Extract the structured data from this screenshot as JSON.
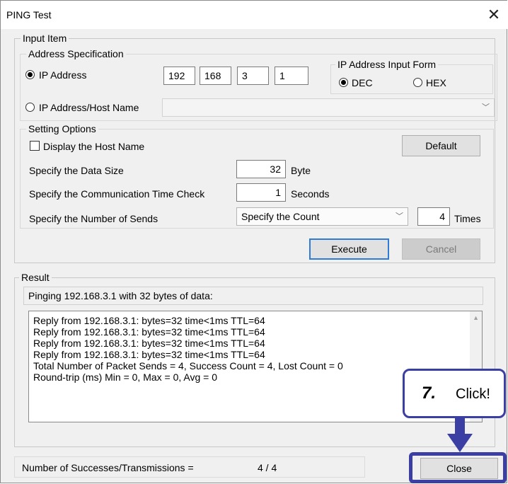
{
  "window": {
    "title": "PING Test"
  },
  "input_item": {
    "group_label": "Input Item",
    "address_spec": {
      "group_label": "Address Specification",
      "ip_address_label": "IP Address",
      "ip_octets": [
        "192",
        "168",
        "3",
        "1"
      ],
      "input_form": {
        "label": "IP Address Input Form",
        "dec": "DEC",
        "hex": "HEX",
        "selected": "DEC"
      },
      "host_name_label": "IP Address/Host Name",
      "host_name_value": "",
      "selected": "IP Address"
    },
    "setting_options": {
      "group_label": "Setting Options",
      "display_host_name": "Display the Host Name",
      "display_host_name_checked": false,
      "default_button": "Default",
      "data_size_label": "Specify the Data Size",
      "data_size_value": "32",
      "data_size_unit": "Byte",
      "time_check_label": "Specify the Communication Time Check",
      "time_check_value": "1",
      "time_check_unit": "Seconds",
      "sends_label": "Specify the Number of Sends",
      "sends_mode": "Specify the Count",
      "sends_count": "4",
      "sends_unit": "Times"
    },
    "execute_button": "Execute",
    "cancel_button": "Cancel"
  },
  "result": {
    "group_label": "Result",
    "summary": "Pinging 192.168.3.1 with 32 bytes of data:",
    "lines": [
      "Reply from 192.168.3.1: bytes=32 time<1ms TTL=64",
      "Reply from 192.168.3.1: bytes=32 time<1ms TTL=64",
      "Reply from 192.168.3.1: bytes=32 time<1ms TTL=64",
      "Reply from 192.168.3.1: bytes=32 time<1ms TTL=64",
      "Total Number of Packet Sends = 4, Success Count = 4, Lost Count = 0",
      "Round-trip (ms) Min = 0, Max = 0, Avg = 0"
    ]
  },
  "status": {
    "label": "Number of Successes/Transmissions =",
    "value": "4  /  4"
  },
  "close_button": "Close",
  "annotation": {
    "step": "7.",
    "action": "Click!"
  },
  "colors": {
    "annotation": "#3b3fa4",
    "focus": "#2f7bd6"
  }
}
